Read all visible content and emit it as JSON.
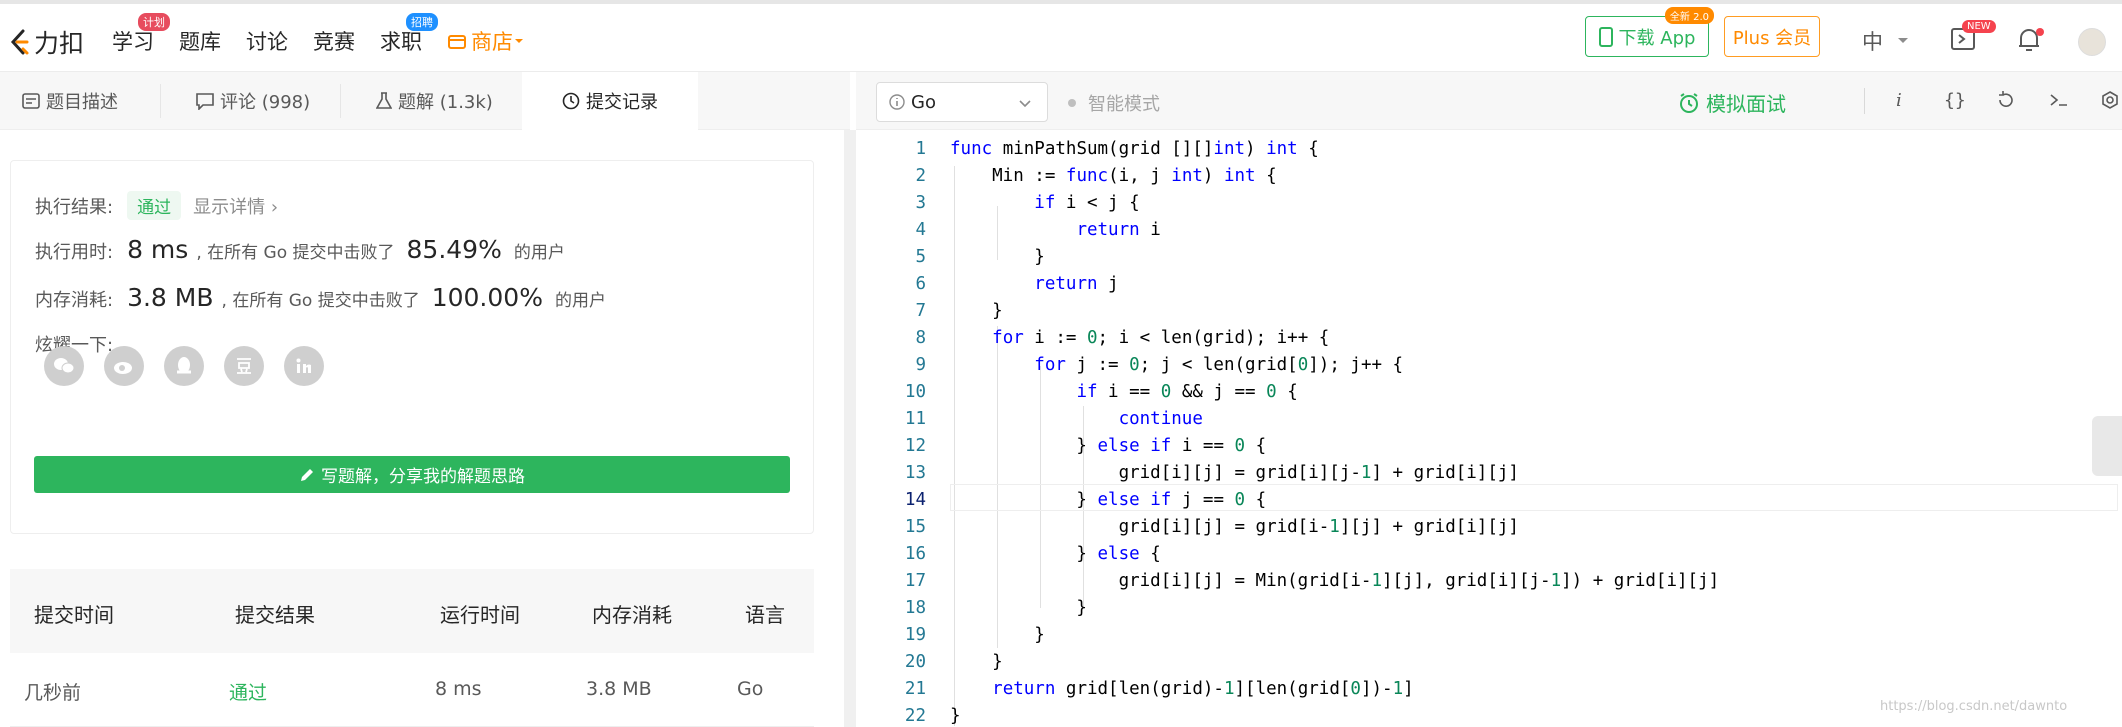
{
  "brand": {
    "name": "力扣",
    "accent": "#ff8a00"
  },
  "nav": {
    "items": [
      {
        "label": "学习",
        "badge": "计划"
      },
      {
        "label": "题库"
      },
      {
        "label": "讨论"
      },
      {
        "label": "竞赛"
      },
      {
        "label": "求职",
        "badge": "招聘"
      }
    ],
    "shop_label": "商店"
  },
  "header": {
    "app_button": "下载 App",
    "app_badge": "全新 2.0",
    "plus_button": "Plus 会员",
    "language": "中",
    "new_badge": "NEW"
  },
  "left_tabs": [
    {
      "label": "题目描述",
      "icon": "description-icon"
    },
    {
      "label": "评论 (998)",
      "icon": "comment-icon"
    },
    {
      "label": "题解 (1.3k)",
      "icon": "flask-icon"
    },
    {
      "label": "提交记录",
      "icon": "clock-icon",
      "active": true
    }
  ],
  "result": {
    "status_label": "执行结果:",
    "status": "通过",
    "details_link": "显示详情",
    "runtime_label": "执行用时:",
    "runtime": "8 ms",
    "runtime_text": ", 在所有 Go 提交中击败了",
    "runtime_pct": "85.49%",
    "users_suffix": "的用户",
    "memory_label": "内存消耗:",
    "memory": "3.8 MB",
    "memory_text": ", 在所有 Go 提交中击败了",
    "memory_pct": "100.00%",
    "share_label": "炫耀一下:",
    "share_icons": [
      "wechat-icon",
      "weibo-icon",
      "qq-icon",
      "douban-icon",
      "linkedin-icon"
    ],
    "write_button": "写题解，分享我的解题思路"
  },
  "submissions": {
    "headers": [
      "提交时间",
      "提交结果",
      "运行时间",
      "内存消耗",
      "语言"
    ],
    "rows": [
      {
        "time": "几秒前",
        "result": "通过",
        "runtime": "8 ms",
        "memory": "3.8 MB",
        "lang": "Go"
      }
    ]
  },
  "editor": {
    "language": "Go",
    "smart_mode": "智能模式",
    "mock_interview": "模拟面试",
    "highlighted_line": 14
  },
  "watermark": "https://blog.csdn.net/dawnto",
  "colors": {
    "green": "#2db55d",
    "orange": "#ff8a00",
    "keyword": "#0000ff",
    "number": "#098658"
  }
}
